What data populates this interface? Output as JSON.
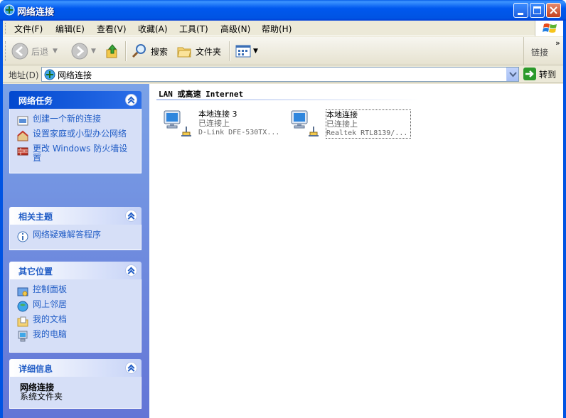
{
  "window": {
    "title": "网络连接",
    "controls": [
      "minimize",
      "maximize",
      "close"
    ]
  },
  "menu": [
    {
      "label": "文件(F)"
    },
    {
      "label": "编辑(E)"
    },
    {
      "label": "查看(V)"
    },
    {
      "label": "收藏(A)"
    },
    {
      "label": "工具(T)"
    },
    {
      "label": "高级(N)"
    },
    {
      "label": "帮助(H)"
    }
  ],
  "toolbar": {
    "back_label": "后退",
    "search_label": "搜索",
    "folders_label": "文件夹",
    "links_label": "链接",
    "more_symbol": "»"
  },
  "address": {
    "label": "地址(D)",
    "value": "网络连接",
    "go_label": "转到"
  },
  "taskpane": {
    "network_tasks": {
      "title": "网络任务",
      "items": [
        {
          "label": "创建一个新的连接",
          "icon": "new-connection-icon"
        },
        {
          "label": "设置家庭或小型办公网络",
          "icon": "home-network-icon"
        },
        {
          "label": "更改 Windows 防火墙设置",
          "icon": "firewall-icon"
        }
      ]
    },
    "related": {
      "title": "相关主题",
      "items": [
        {
          "label": "网络疑难解答程序",
          "icon": "info-icon"
        }
      ]
    },
    "other_places": {
      "title": "其它位置",
      "items": [
        {
          "label": "控制面板",
          "icon": "control-panel-icon"
        },
        {
          "label": "网上邻居",
          "icon": "network-places-icon"
        },
        {
          "label": "我的文档",
          "icon": "my-documents-icon"
        },
        {
          "label": "我的电脑",
          "icon": "my-computer-icon"
        }
      ]
    },
    "details": {
      "title": "详细信息",
      "name": "网络连接",
      "type": "系统文件夹"
    }
  },
  "content": {
    "group_title": "LAN 或高速 Internet",
    "connections": [
      {
        "name": "本地连接 3",
        "status": "已连接上",
        "device": "D-Link DFE-530TX...",
        "selected": false
      },
      {
        "name": "本地连接",
        "status": "已连接上",
        "device": "Realtek RTL8139/...",
        "selected": true
      }
    ]
  },
  "colors": {
    "title_blue": "#0054e3",
    "taskpane_gradient_top": "#7ba2e7",
    "taskpane_gradient_bottom": "#6375d6",
    "task_link": "#215dc6",
    "panel_body": "#d6dff7"
  }
}
